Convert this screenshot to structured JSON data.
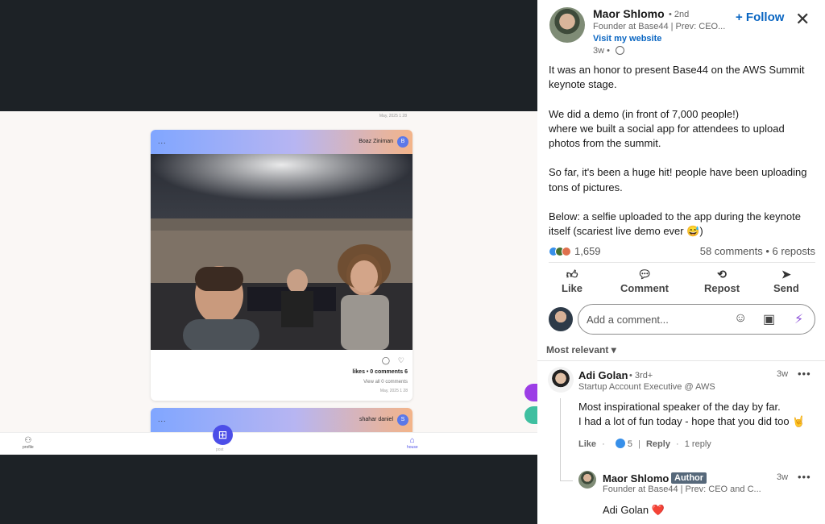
{
  "app_feed": {
    "top_card_date": "May, 2025 1 28",
    "card1": {
      "menu": "...",
      "user": "Boaz Ziniman",
      "avatar_letter": "B",
      "likes_line": "likes • 0 comments 6",
      "view_all": "View all 0 comments",
      "date": "May, 2025 1 28"
    },
    "card2": {
      "menu": "...",
      "user": "shahar daniel",
      "avatar_letter": "S"
    },
    "nav": {
      "profile_label": "profile",
      "post_label": "post",
      "house_label": "house",
      "profile_icon": "person-icon",
      "post_icon": "plus-square-icon",
      "house_icon": "house-icon"
    },
    "colors": {
      "accent": "#4c4ee8",
      "fab_purple": "#9c3ee6",
      "fab_teal": "#3fbfa0"
    }
  },
  "post": {
    "author": {
      "name": "Maor Shlomo",
      "degree": "• 2nd",
      "headline": "Founder at Base44 | Prev: CEO...",
      "link": "Visit my website",
      "time": "3w •"
    },
    "follow_label": "+ Follow",
    "close_label": "✕",
    "body": [
      "It was an honor to present Base44 on the AWS Summit keynote stage.",
      "We did a demo (in front of 7,000 people!)\nwhere we built a social app for attendees to upload photos from the summit.",
      "So far, it's been a huge hit! people have been uploading tons of pictures.",
      "Below: a selfie uploaded to the app during the keynote itself (scariest live demo ever 😅)"
    ],
    "reaction_count": "1,659",
    "comments_reposts": "58 comments • 6 reposts",
    "actions": [
      {
        "label": "Like",
        "icon": "thumbs-up-icon"
      },
      {
        "label": "Comment",
        "icon": "comment-icon"
      },
      {
        "label": "Repost",
        "icon": "repost-icon"
      },
      {
        "label": "Send",
        "icon": "send-icon"
      }
    ],
    "comment_placeholder": "Add a comment...",
    "sort_label": "Most relevant ▾",
    "brand_color": "#0a66c2"
  },
  "comments": [
    {
      "name": "Adi Golan",
      "degree": "• 3rd+",
      "headline": "Startup Account Executive @ AWS",
      "time": "3w",
      "more": "•••",
      "text_line1": "Most inspirational speaker of the day by far.",
      "text_line2": "I had a lot of fun today - hope that you did too 🤘",
      "like_label": "Like",
      "like_count": "5",
      "reply_label": "Reply",
      "replies": "1 reply"
    },
    {
      "name": "Maor Shlomo",
      "badge": "Author",
      "headline": "Founder at Base44 | Prev: CEO and C...",
      "time": "3w",
      "more": "•••",
      "text": "Adi Golan ❤️"
    }
  ]
}
